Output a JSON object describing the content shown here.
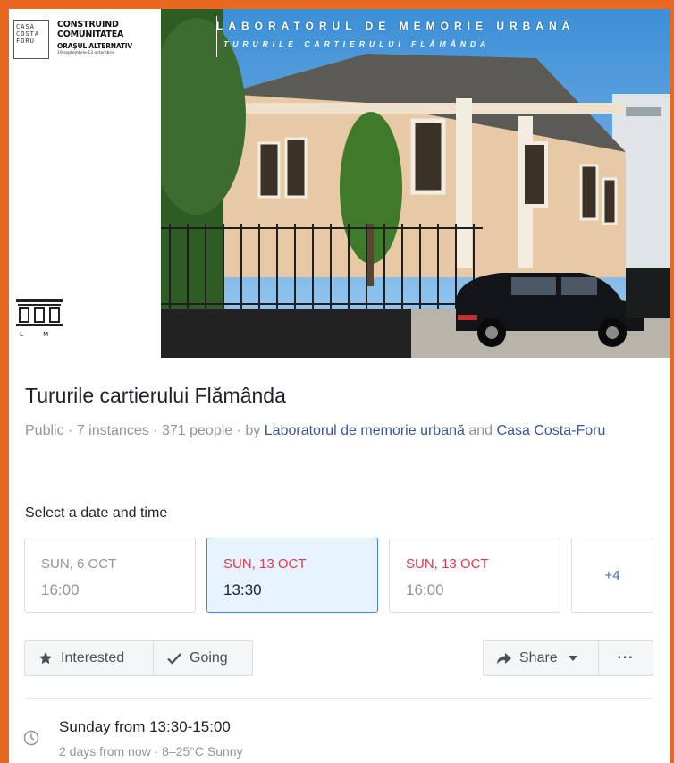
{
  "banner": {
    "logo_box_text": "CASA COSTA FORU",
    "logo_line1": "CONSTRUIND",
    "logo_line2": "COMUNITATEA",
    "logo_line3": "ORAȘUL ALTERNATIV",
    "logo_dates": "19 septembrie-13 octombrie",
    "title": "LABORATORUL DE MEMORIE URBANĂ",
    "subtitle": "TURURILE CARTIERULUI FLĂMÂNDA",
    "building_logo_text": "L M U"
  },
  "event": {
    "title": "Tururile cartierului Flămânda",
    "privacy": "Public",
    "instances": "7 instances",
    "people": "371 people",
    "by_prefix": "by",
    "host1": "Laboratorul de memorie urbană",
    "and": "and",
    "host2": "Casa Costa-Foru",
    "separator": "·"
  },
  "dates": {
    "label": "Select a date and time",
    "items": [
      {
        "day": "SUN, 6 OCT",
        "time": "16:00",
        "selected": false,
        "highlight": false
      },
      {
        "day": "SUN, 13 OCT",
        "time": "13:30",
        "selected": true,
        "highlight": true
      },
      {
        "day": "SUN, 13 OCT",
        "time": "16:00",
        "selected": false,
        "highlight": true
      }
    ],
    "more": "+4"
  },
  "actions": {
    "interested": "Interested",
    "going": "Going",
    "share": "Share",
    "more": "···"
  },
  "when": {
    "main": "Sunday from 13:30-15:00",
    "sub": "2 days from now · 8–25°C Sunny"
  },
  "colors": {
    "accent": "#4267b2",
    "link": "#385898",
    "red": "#e03a4a",
    "border_frame": "#e8681f",
    "selected_bg": "#e7f3ff"
  }
}
